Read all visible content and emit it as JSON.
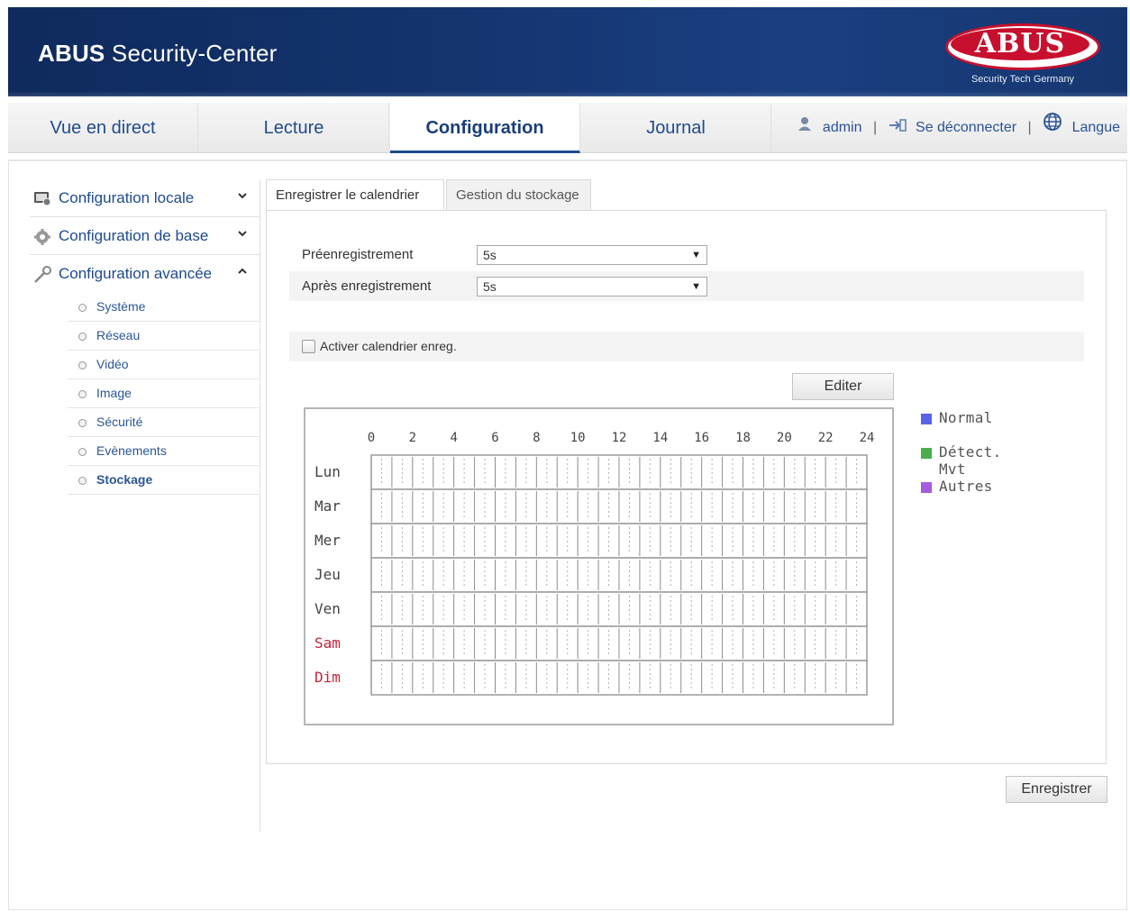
{
  "header": {
    "title_bold": "ABUS",
    "title_rest": "Security-Center",
    "logo_text": "ABUS",
    "logo_tagline": "Security Tech Germany"
  },
  "nav": {
    "tabs": [
      {
        "label": "Vue en direct"
      },
      {
        "label": "Lecture"
      },
      {
        "label": "Configuration",
        "active": true
      },
      {
        "label": "Journal"
      }
    ],
    "user": "admin",
    "separator": "|",
    "logout": "Se déconnecter",
    "language": "Langue"
  },
  "sidebar": {
    "groups": [
      {
        "label": "Configuration locale",
        "icon": "monitor-config-icon",
        "expanded": false
      },
      {
        "label": "Configuration de base",
        "icon": "gear-icon",
        "expanded": false
      },
      {
        "label": "Configuration avancée",
        "icon": "wrench-icon",
        "expanded": true
      }
    ],
    "items": [
      {
        "label": "Système"
      },
      {
        "label": "Réseau"
      },
      {
        "label": "Vidéo"
      },
      {
        "label": "Image"
      },
      {
        "label": "Sécurité"
      },
      {
        "label": "Evènements"
      },
      {
        "label": "Stockage",
        "active": true
      }
    ]
  },
  "tabs": [
    {
      "label": "Enregistrer le calendrier",
      "active": true
    },
    {
      "label": "Gestion du stockage"
    }
  ],
  "form": {
    "pre_record_label": "Préenregistrement",
    "pre_record_value": "5s",
    "post_record_label": "Après enregistrement",
    "post_record_value": "5s",
    "dropdown_arrow": "▼",
    "enable_label": "Activer calendrier enreg.",
    "enable_checked": false
  },
  "schedule": {
    "edit_label": "Editer",
    "hour_labels": [
      "0",
      "2",
      "4",
      "6",
      "8",
      "10",
      "12",
      "14",
      "16",
      "18",
      "20",
      "22",
      "24"
    ],
    "days": [
      {
        "label": "Lun",
        "weekend": false
      },
      {
        "label": "Mar",
        "weekend": false
      },
      {
        "label": "Mer",
        "weekend": false
      },
      {
        "label": "Jeu",
        "weekend": false
      },
      {
        "label": "Ven",
        "weekend": false
      },
      {
        "label": "Sam",
        "weekend": true
      },
      {
        "label": "Dim",
        "weekend": true
      }
    ],
    "weekday_color": "#444444",
    "weekend_color": "#c0253a"
  },
  "legend": [
    {
      "label": "Normal",
      "color": "#5b64e8"
    },
    {
      "label": "Détect. Mvt",
      "color": "#4cae4c"
    },
    {
      "label": "Autres",
      "color": "#a55ce0"
    }
  ],
  "save_label": "Enregistrer"
}
